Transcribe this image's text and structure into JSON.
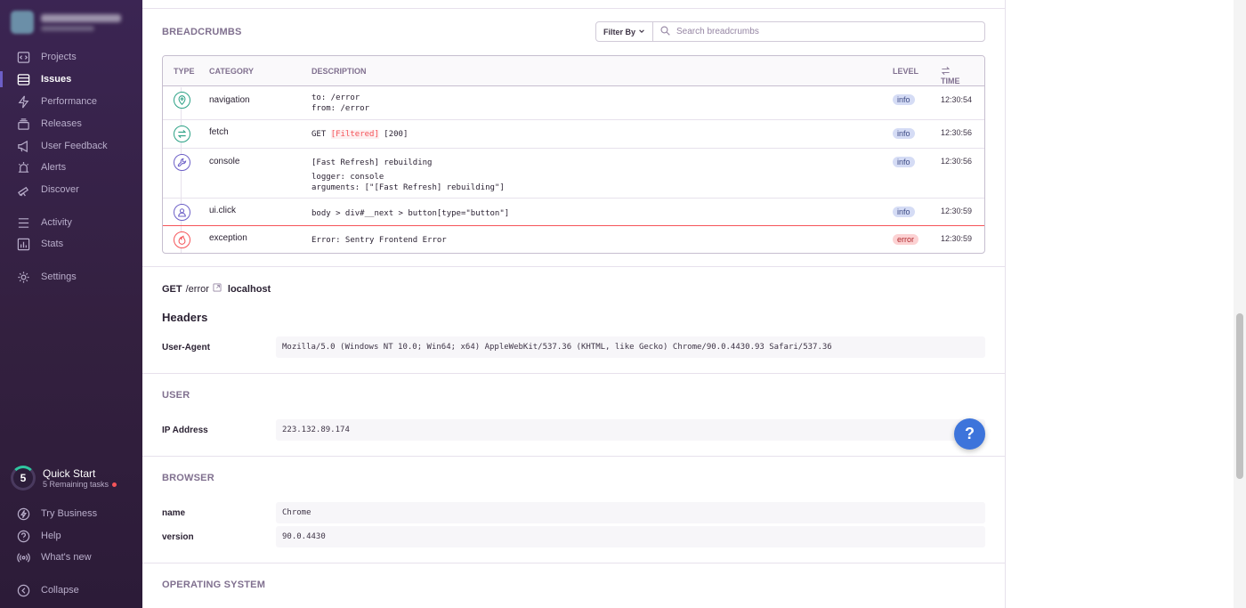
{
  "sidebar": {
    "items": [
      {
        "label": "Projects",
        "icon": "projects-icon"
      },
      {
        "label": "Issues",
        "icon": "issues-icon",
        "active": true
      },
      {
        "label": "Performance",
        "icon": "lightning-icon"
      },
      {
        "label": "Releases",
        "icon": "releases-icon"
      },
      {
        "label": "User Feedback",
        "icon": "megaphone-icon"
      },
      {
        "label": "Alerts",
        "icon": "siren-icon"
      },
      {
        "label": "Discover",
        "icon": "telescope-icon"
      },
      {
        "label": "Activity",
        "icon": "list-icon"
      },
      {
        "label": "Stats",
        "icon": "stats-icon"
      },
      {
        "label": "Settings",
        "icon": "gear-icon"
      }
    ],
    "quick_start": {
      "count": "5",
      "title": "Quick Start",
      "subtitle": "5 Remaining tasks"
    },
    "footer": [
      {
        "label": "Try Business",
        "icon": "business-icon"
      },
      {
        "label": "Help",
        "icon": "question-icon"
      },
      {
        "label": "What's new",
        "icon": "broadcast-icon"
      },
      {
        "label": "Collapse",
        "icon": "collapse-icon"
      }
    ]
  },
  "breadcrumbs": {
    "title": "BREADCRUMBS",
    "filter_label": "Filter By",
    "search_placeholder": "Search breadcrumbs",
    "columns": {
      "type": "TYPE",
      "category": "CATEGORY",
      "description": "DESCRIPTION",
      "level": "LEVEL",
      "time": "TIME"
    },
    "rows": [
      {
        "category": "navigation",
        "desc_lines": [
          "to: /error",
          "from: /error"
        ],
        "level": "info",
        "time": "12:30:54",
        "icon": "location-pin-icon",
        "color": "#2ba185"
      },
      {
        "category": "fetch",
        "desc_pre": "GET ",
        "desc_filtered": "[Filtered]",
        "desc_post": " [200]",
        "level": "info",
        "time": "12:30:56",
        "icon": "swap-arrows-icon",
        "color": "#2ba185"
      },
      {
        "category": "console",
        "desc_lines": [
          "[Fast Refresh] rebuilding",
          "logger: console",
          "arguments: [\"[Fast Refresh] rebuilding\"]"
        ],
        "level": "info",
        "time": "12:30:56",
        "icon": "wrench-icon",
        "color": "#6c5fc7"
      },
      {
        "category": "ui.click",
        "desc_lines": [
          "body > div#__next > button[type=\"button\"]"
        ],
        "level": "info",
        "time": "12:30:59",
        "icon": "user-icon",
        "color": "#6c5fc7"
      },
      {
        "category": "exception",
        "desc_lines": [
          "Error: Sentry Frontend Error"
        ],
        "level": "error",
        "time": "12:30:59",
        "icon": "fire-icon",
        "color": "#f55459"
      }
    ]
  },
  "request": {
    "method": "GET",
    "path": "/error",
    "host": "localhost",
    "headers_title": "Headers",
    "headers": [
      {
        "key": "User-Agent",
        "value": "Mozilla/5.0 (Windows NT 10.0; Win64; x64) AppleWebKit/537.36 (KHTML, like Gecko) Chrome/90.0.4430.93 Safari/537.36"
      }
    ]
  },
  "user": {
    "title": "USER",
    "rows": [
      {
        "key": "IP Address",
        "value": "223.132.89.174"
      }
    ]
  },
  "browser": {
    "title": "BROWSER",
    "rows": [
      {
        "key": "name",
        "value": "Chrome"
      },
      {
        "key": "version",
        "value": "90.0.4430"
      }
    ]
  },
  "os": {
    "title": "OPERATING SYSTEM"
  },
  "help_fab": "?"
}
